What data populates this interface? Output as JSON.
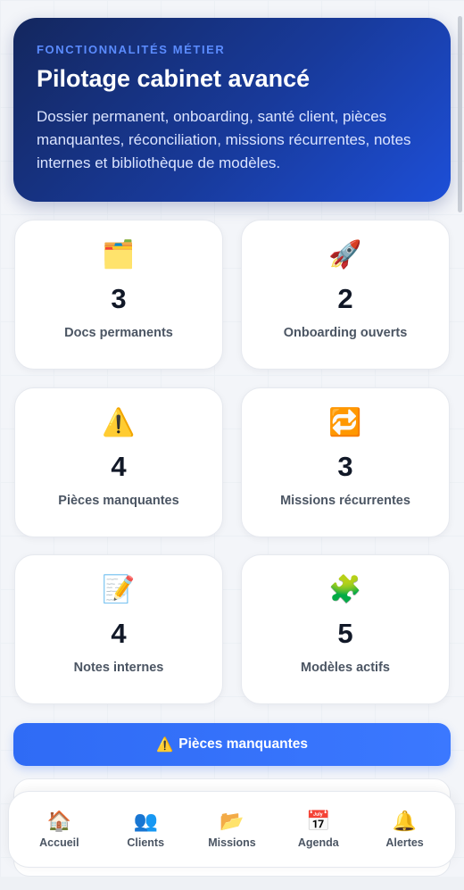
{
  "hero": {
    "eyebrow": "FONCTIONNALITÉS MÉTIER",
    "title": "Pilotage cabinet avancé",
    "description": "Dossier permanent, onboarding, santé client, pièces manquantes, réconciliation, missions récurrentes, notes internes et bibliothèque de modèles."
  },
  "stats": [
    {
      "icon": "🗂️",
      "icon_name": "folder-icon",
      "value": "3",
      "label": "Docs permanents"
    },
    {
      "icon": "🚀",
      "icon_name": "rocket-icon",
      "value": "2",
      "label": "Onboarding ouverts"
    },
    {
      "icon": "⚠️",
      "icon_name": "warning-icon",
      "value": "4",
      "label": "Pièces manquantes"
    },
    {
      "icon": "🔁",
      "icon_name": "repeat-icon",
      "value": "3",
      "label": "Missions récurrentes"
    },
    {
      "icon": "📝",
      "icon_name": "memo-icon",
      "value": "4",
      "label": "Notes internes"
    },
    {
      "icon": "🧩",
      "icon_name": "puzzle-icon",
      "value": "5",
      "label": "Modèles actifs"
    }
  ],
  "alert_button": {
    "icon": "⚠️",
    "label": "Pièces manquantes"
  },
  "nav": [
    {
      "icon": "🏠",
      "label": "Accueil"
    },
    {
      "icon": "👥",
      "label": "Clients"
    },
    {
      "icon": "📂",
      "label": "Missions"
    },
    {
      "icon": "📅",
      "label": "Agenda"
    },
    {
      "icon": "🔔",
      "label": "Alertes"
    }
  ],
  "colors": {
    "accent": "#2f6bf5",
    "hero_start": "#14275e",
    "hero_end": "#1d4fd8"
  }
}
